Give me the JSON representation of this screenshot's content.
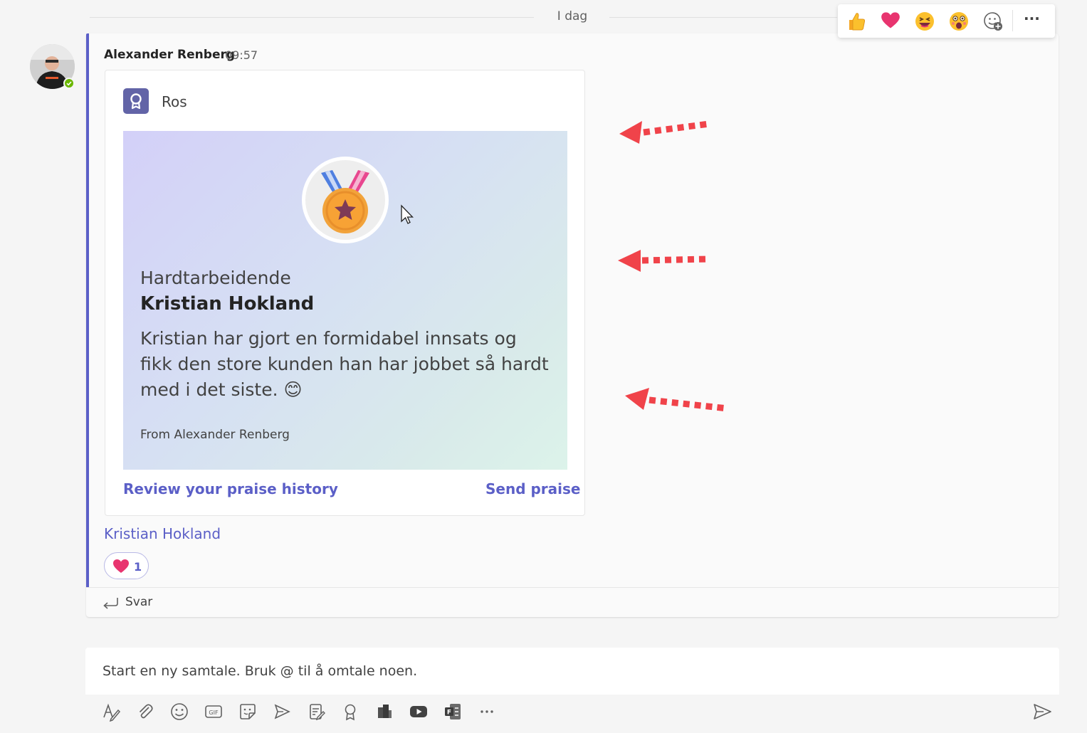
{
  "date_divider": "I dag",
  "message": {
    "author": "Alexander Renberg",
    "time": "09:57",
    "card_app_label": "Ros",
    "badge_title": "Hardtarbeidende",
    "recipient": "Kristian Hokland",
    "praise_text": "Kristian har gjort en formidabel innsats og fikk den store kunden han har jobbet så hardt med i det siste.",
    "praise_emoji": "😊",
    "from_text": "From Alexander Renberg",
    "link_history": "Review your praise history",
    "link_send": "Send praise",
    "mention": "Kristian Hokland",
    "reaction_emoji": "❤",
    "reaction_count": "1",
    "reply_label": "Svar"
  },
  "reaction_bar": {
    "items": [
      "like-icon",
      "heart-icon",
      "laugh-icon",
      "surprised-icon",
      "add-reaction-icon",
      "more-options-icon"
    ],
    "more_label": "···"
  },
  "compose": {
    "placeholder": "Start en ny samtale. Bruk @ til å omtale noen."
  },
  "toolbar_icons": [
    "format-icon",
    "attach-icon",
    "emoji-icon",
    "gif-icon",
    "sticker-icon",
    "schedule-meeting-icon",
    "approvals-icon",
    "praise-icon",
    "stream-icon",
    "youtube-icon",
    "forms-icon",
    "more-icon",
    "send-icon"
  ],
  "colors": {
    "accent": "#5b5fc7",
    "arrow": "#f0434a",
    "presence": "#6bb700"
  }
}
